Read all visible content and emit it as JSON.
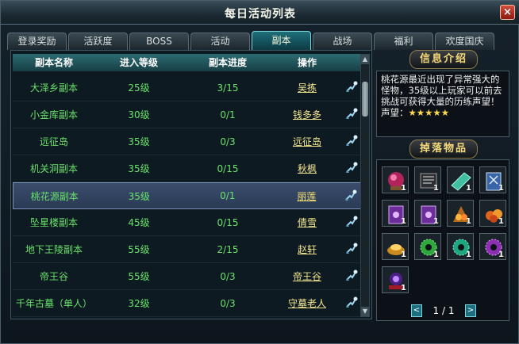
{
  "window": {
    "title": "每日活动列表",
    "close_label": "×"
  },
  "tabs": [
    {
      "label": "登录奖励",
      "active": false
    },
    {
      "label": "活跃度",
      "active": false
    },
    {
      "label": "BOSS",
      "active": false
    },
    {
      "label": "活动",
      "active": false
    },
    {
      "label": "副本",
      "active": true
    },
    {
      "label": "战场",
      "active": false
    },
    {
      "label": "福利",
      "active": false
    },
    {
      "label": "欢度国庆",
      "active": false
    }
  ],
  "table": {
    "headers": [
      "副本名称",
      "进入等级",
      "副本进度",
      "操作"
    ],
    "rows": [
      {
        "name": "大泽乡副本",
        "level": "25级",
        "progress": "3/15",
        "npc": "吴拣",
        "selected": false
      },
      {
        "name": "小金库副本",
        "level": "30级",
        "progress": "0/1",
        "npc": "钱多多",
        "selected": false
      },
      {
        "name": "远征岛",
        "level": "35级",
        "progress": "0/3",
        "npc": "远征岛",
        "selected": false
      },
      {
        "name": "机关洞副本",
        "level": "35级",
        "progress": "0/15",
        "npc": "秋枫",
        "selected": false
      },
      {
        "name": "桃花源副本",
        "level": "35级",
        "progress": "0/1",
        "npc": "丽莲",
        "selected": true
      },
      {
        "name": "坠星楼副本",
        "level": "45级",
        "progress": "0/15",
        "npc": "倩雪",
        "selected": false
      },
      {
        "name": "地下王陵副本",
        "level": "55级",
        "progress": "2/15",
        "npc": "赵轩",
        "selected": false
      },
      {
        "name": "帝王谷",
        "level": "55级",
        "progress": "0/3",
        "npc": "帝王谷",
        "selected": false
      },
      {
        "name": "千年古墓（单人）",
        "level": "32级",
        "progress": "0/3",
        "npc": "守墓老人",
        "selected": false
      }
    ]
  },
  "info": {
    "title": "信息介绍",
    "text": "桃花源最近出现了异常强大的怪物，35级以上玩家可以前去挑战可获得大量的历练声望！",
    "reputation_label": "声望：",
    "stars": "★★★★★"
  },
  "drops": {
    "title": "掉落物品",
    "items": [
      {
        "icon": "red-orb-icon",
        "qty": "1"
      },
      {
        "icon": "black-scroll-icon",
        "qty": "1"
      },
      {
        "icon": "jade-bar-icon",
        "qty": "1"
      },
      {
        "icon": "blue-book-icon",
        "qty": "1"
      },
      {
        "icon": "purple-book-icon",
        "qty": "1"
      },
      {
        "icon": "purple-book-icon",
        "qty": "1"
      },
      {
        "icon": "orange-gem-cluster-icon",
        "qty": "1"
      },
      {
        "icon": "orange-fruit-icon",
        "qty": "1"
      },
      {
        "icon": "gold-ingot-icon",
        "qty": "1"
      },
      {
        "icon": "green-jade-icon",
        "qty": "1"
      },
      {
        "icon": "teal-jade-icon",
        "qty": "1"
      },
      {
        "icon": "violet-jade-icon",
        "qty": "1"
      },
      {
        "icon": "purple-orb-icon",
        "qty": "1"
      }
    ],
    "pager": {
      "prev": "<",
      "next": ">",
      "text": "1 / 1"
    }
  }
}
